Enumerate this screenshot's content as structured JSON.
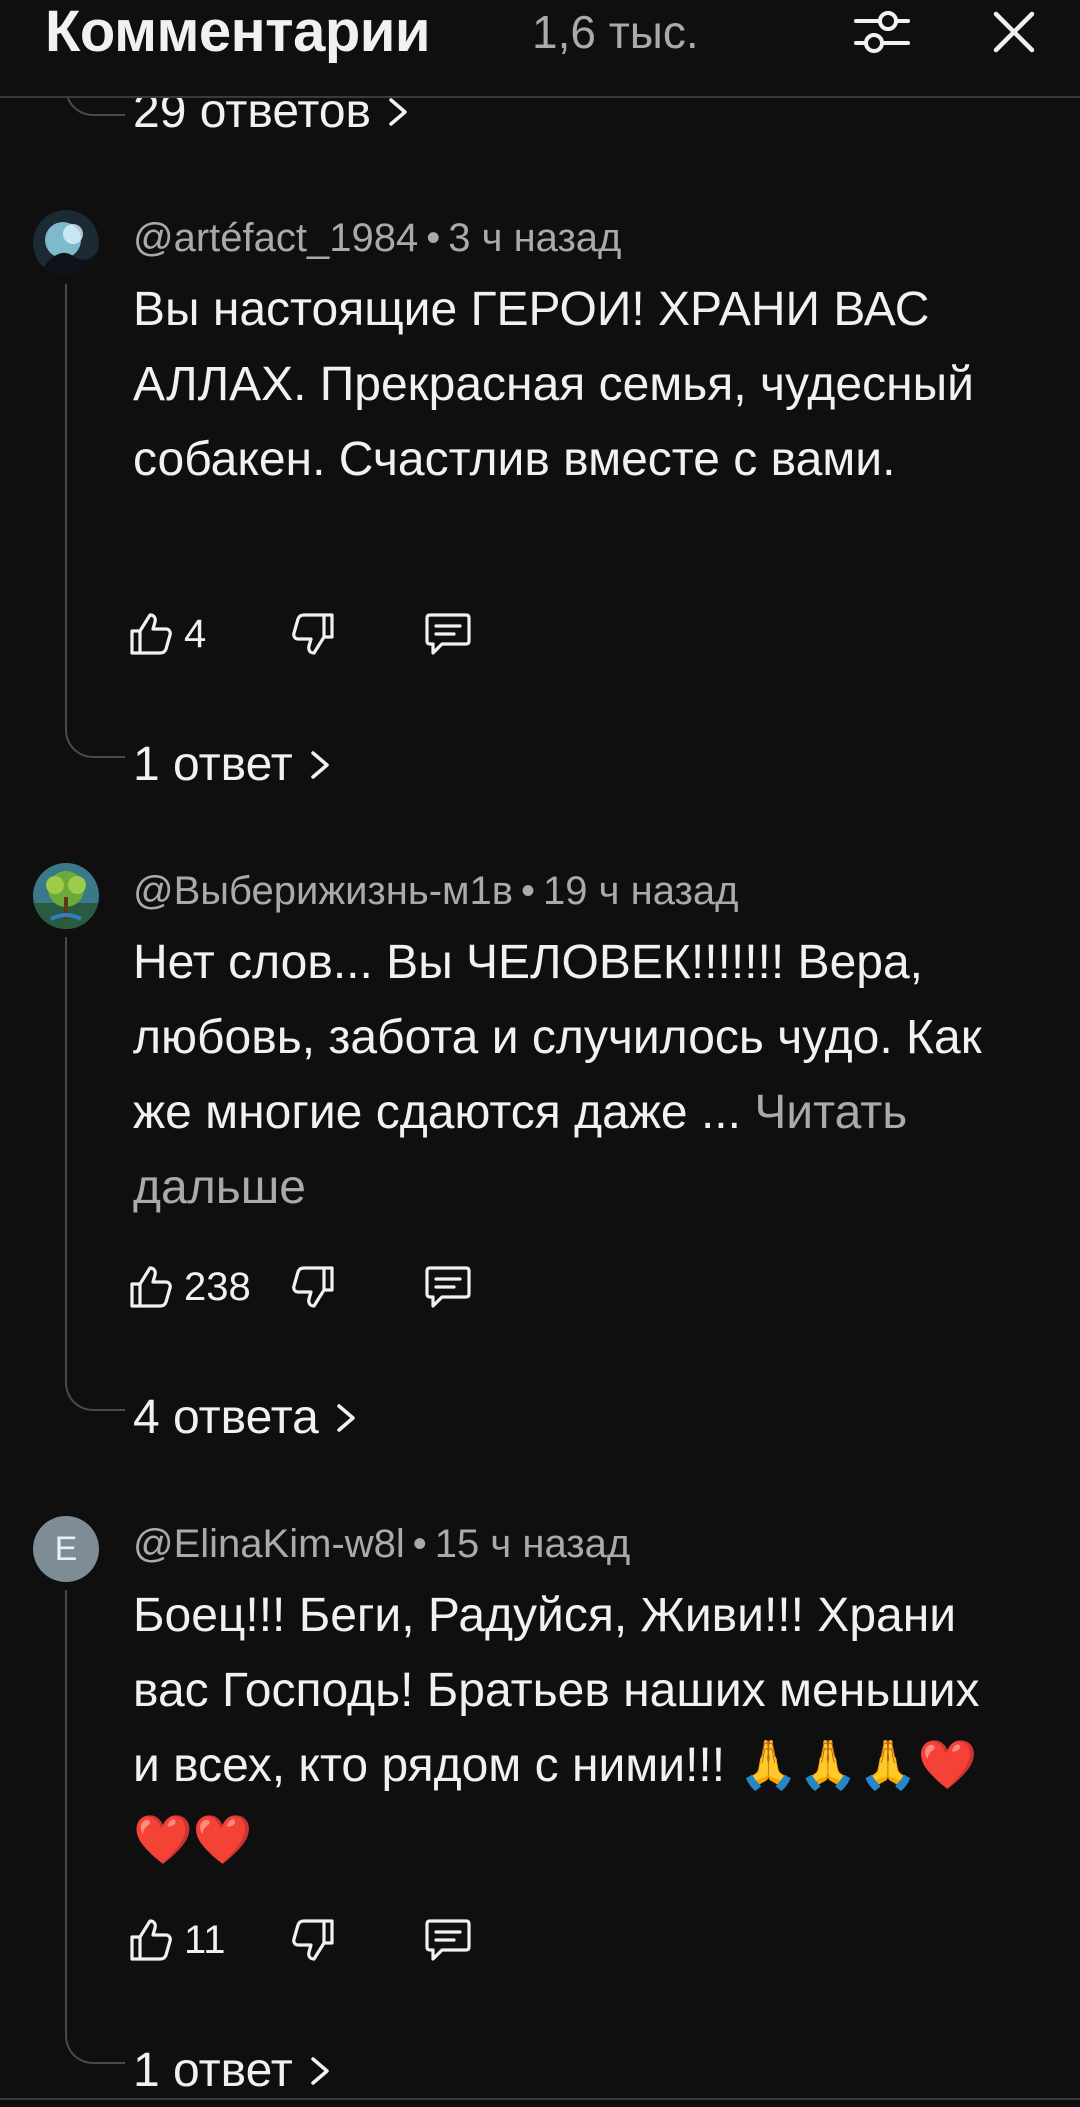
{
  "header": {
    "title": "Комментарии",
    "count": "1,6 тыс."
  },
  "top_replies": "29 ответов",
  "comments": [
    {
      "author": "@artéfact_1984",
      "separator": "•",
      "time": "3 ч назад",
      "text": "Вы настоящие ГЕРОИ! ХРАНИ ВАС АЛЛАХ. Прекрасная семья, чудесный собакен. Счастлив вместе с вами.",
      "likes": "4",
      "replies": "1 ответ"
    },
    {
      "author": "@Выберижизнь-м1в",
      "separator": "•",
      "time": "19 ч назад",
      "text": "Нет слов... Вы ЧЕЛОВЕК!!!!!!! Вера, любовь, забота и случилось чудо. Как же многие сдаются даже ...",
      "read_more": "Читать дальше",
      "likes": "238",
      "replies": "4 ответа"
    },
    {
      "author": "@ElinaKim-w8l",
      "separator": "•",
      "time": "15 ч назад",
      "avatar_letter": "E",
      "text": "Боец!!! Беги, Радуйся, Живи!!! Храни вас Господь! Братьев наших меньших и всех, кто рядом с ними!!!",
      "emoji_pray": "🙏🙏🙏",
      "emoji_hearts": "❤️❤️❤️",
      "likes": "11",
      "replies": "1 ответ"
    }
  ],
  "colors": {
    "background": "#0f0f0f",
    "text": "#f1f1f1",
    "secondary": "#aaaaaa",
    "thread": "#4a4a4a"
  },
  "icons": {
    "filter": "sliders-icon",
    "close": "close-icon",
    "like": "thumb-up-icon",
    "dislike": "thumb-down-icon",
    "reply": "comment-reply-icon",
    "chevron": "chevron-right-icon"
  }
}
